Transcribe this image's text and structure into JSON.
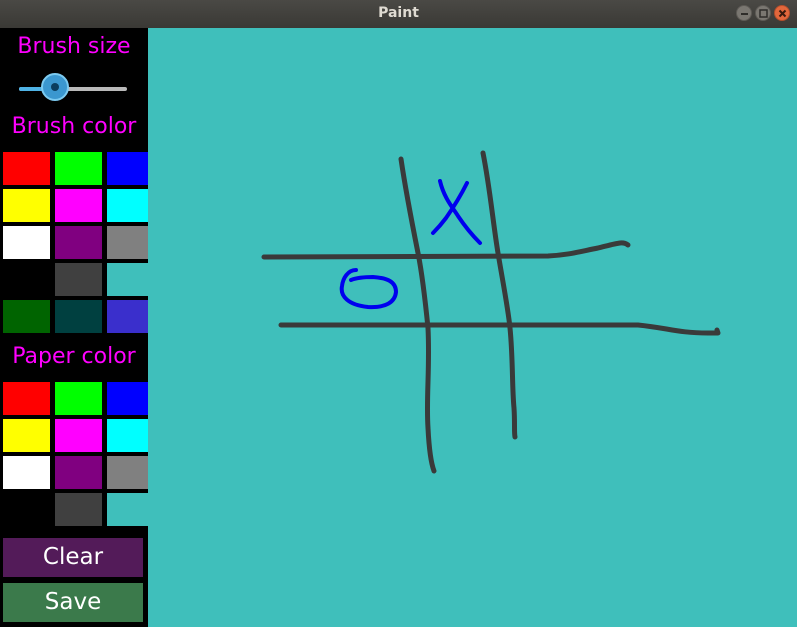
{
  "window": {
    "title": "Paint"
  },
  "panel": {
    "brush_size_label": "Brush size",
    "brush_size_value": 0.33,
    "brush_color_label": "Brush color",
    "paper_color_label": "Paper color",
    "brush_colors": [
      "#ff0000",
      "#00ff00",
      "#0000ff",
      "#ffff00",
      "#ff00ff",
      "#00ffff",
      "#ffffff",
      "#800080",
      "#808080",
      "#000000",
      "#404040",
      "#3fbfbb",
      "#006400",
      "#004040",
      "#3a2fcc"
    ],
    "paper_colors": [
      "#ff0000",
      "#00ff00",
      "#0000ff",
      "#ffff00",
      "#ff00ff",
      "#00ffff",
      "#ffffff",
      "#800080",
      "#808080",
      "#000000",
      "#404040",
      "#3fbfbb"
    ],
    "clear_label": "Clear",
    "save_label": "Save",
    "clear_color": "#531b59",
    "save_color": "#3b7a4b"
  },
  "canvas": {
    "paper_color": "#3fbfbb",
    "grid_stroke_color": "#3a3a3a",
    "mark_color": "#0000ee",
    "marks": [
      "X",
      "O"
    ]
  }
}
